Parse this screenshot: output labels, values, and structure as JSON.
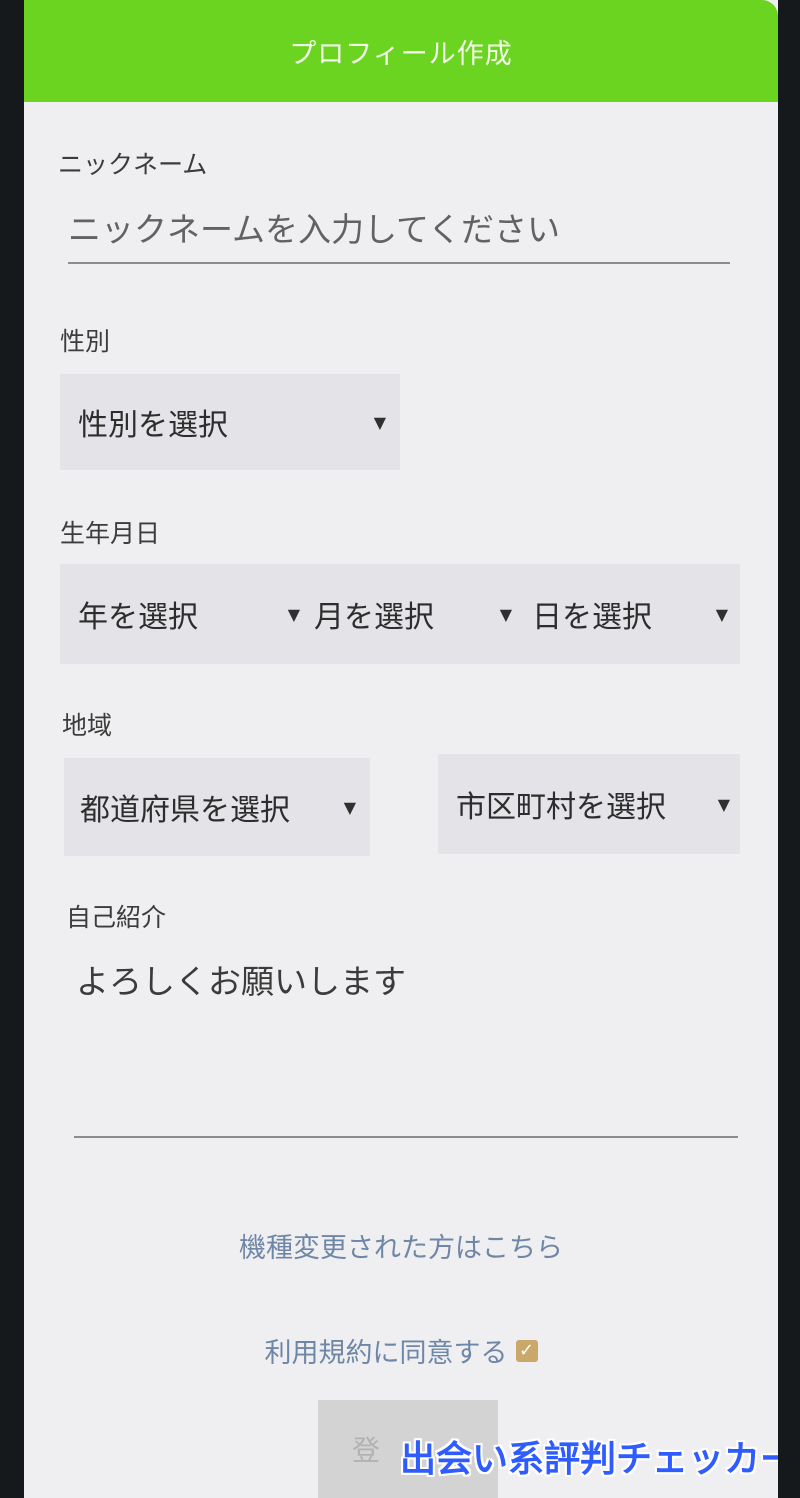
{
  "header": {
    "title": "プロフィール作成"
  },
  "nickname": {
    "label": "ニックネーム",
    "placeholder": "ニックネームを入力してください"
  },
  "gender": {
    "label": "性別",
    "select": "性別を選択"
  },
  "birthdate": {
    "label": "生年月日",
    "year": "年を選択",
    "month": "月を選択",
    "day": "日を選択"
  },
  "region": {
    "label": "地域",
    "prefecture": "都道府県を選択",
    "city": "市区町村を選択"
  },
  "intro": {
    "label": "自己紹介",
    "value": "よろしくお願いします"
  },
  "device_change_link": "機種変更された方はこちら",
  "terms": {
    "label": "利用規約に同意する",
    "checked": true
  },
  "register_button": "登",
  "watermark": "出会い系評判チェッカー",
  "colors": {
    "header": "#6bd421",
    "link": "#6f87a6",
    "checkbox": "#c9a86a",
    "watermark": "#2e5cff"
  }
}
